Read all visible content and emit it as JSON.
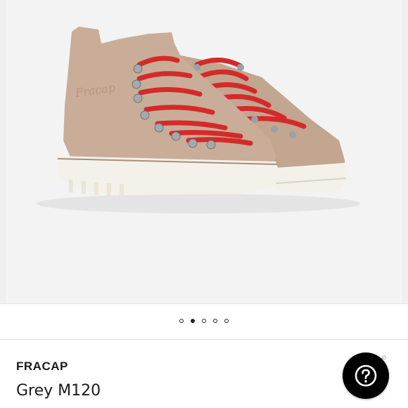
{
  "carousel": {
    "slide_count": 5,
    "active_index": 1,
    "image_icon": "boot-photo"
  },
  "product": {
    "brand": "FRACAP",
    "title": "Grey M120"
  },
  "actions": {
    "help_icon": "question-mark-icon",
    "share_icon": "share-icon"
  },
  "colors": {
    "suede": "#c9ad98",
    "laces": "#d42a2a",
    "sole": "#f4f1ea",
    "help_button": "#000000"
  }
}
